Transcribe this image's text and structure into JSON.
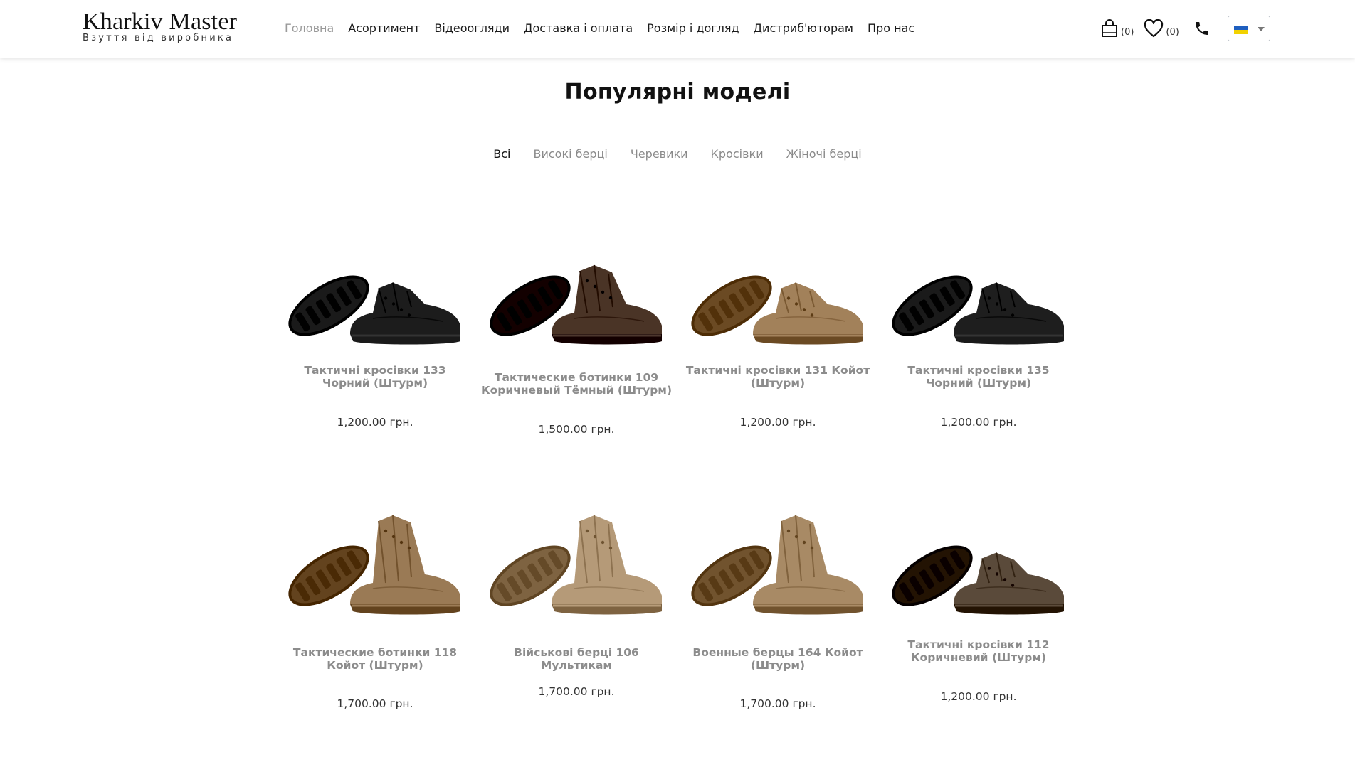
{
  "brand": {
    "title": "Kharkiv Master",
    "subtitle": "Взуття від виробника"
  },
  "nav": [
    {
      "label": "Головна",
      "active": true
    },
    {
      "label": "Асортимент"
    },
    {
      "label": "Відеоогляди"
    },
    {
      "label": "Доставка і оплата"
    },
    {
      "label": "Розмір і догляд"
    },
    {
      "label": "Дистриб'юторам"
    },
    {
      "label": "Про нас"
    }
  ],
  "header_icons": {
    "cart_count": "(0)",
    "wishlist_count": "(0)",
    "cart_icon": "shopping-bag-icon",
    "wishlist_icon": "heart-icon",
    "phone_icon": "phone-icon"
  },
  "language": {
    "selected": "ua-flag"
  },
  "section_title": "Популярні моделі",
  "filters": [
    "Всі",
    "Високі берці",
    "Черевики",
    "Кросівки",
    "Жіночі берці"
  ],
  "products": [
    {
      "name": "Тактичні кросівки 133 Чорний (Штурм)",
      "price": "1,200.00 грн.",
      "color": "#1c1c1c",
      "style": "low"
    },
    {
      "name": "Тактические ботинки 109 Коричневый Тёмный (Штурм)",
      "price": "1,500.00 грн.",
      "color": "#4a3426",
      "style": "mid"
    },
    {
      "name": "Тактичні кросівки 131 Койот (Штурм)",
      "price": "1,200.00 грн.",
      "color": "#a2815a",
      "style": "low"
    },
    {
      "name": "Тактичні кросівки 135 Чорний (Штурм)",
      "price": "1,200.00 грн.",
      "color": "#1e1e1e",
      "style": "low"
    },
    {
      "name": "Тактические ботинки 118 Койот (Штурм)",
      "price": "1,700.00 грн.",
      "color": "#9a7a55",
      "style": "high"
    },
    {
      "name": "Військові берці 106 Мультикам",
      "price": "1,700.00 грн.",
      "color": "#b59a78",
      "style": "high"
    },
    {
      "name": "Военные берцы 164 Койот (Штурм)",
      "price": "1,700.00 грн.",
      "color": "#a88a65",
      "style": "high"
    },
    {
      "name": "Тактичні кросівки 112 Коричневий (Штурм)",
      "price": "1,200.00 грн.",
      "color": "#5a4a3a",
      "style": "low"
    }
  ]
}
